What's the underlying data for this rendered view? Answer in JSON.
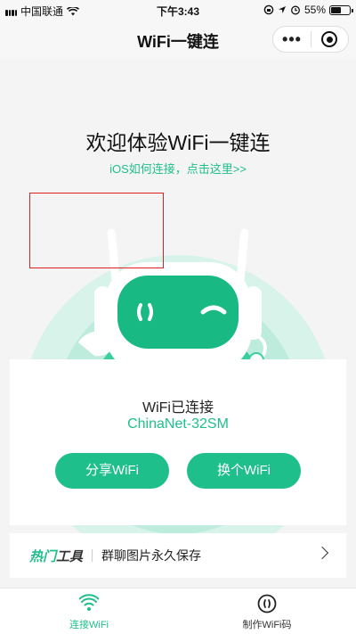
{
  "status_bar": {
    "carrier": "中国联通",
    "time": "下午3:43",
    "battery": "55%",
    "battery_level": 0.55
  },
  "nav": {
    "title": "WiFi一键连",
    "more_icon": "more-dots-icon",
    "close_icon": "target-close-icon"
  },
  "hero": {
    "welcome": "欢迎体验WiFi一键连",
    "ios_link": "iOS如何连接，点击这里>>"
  },
  "card": {
    "status": "WiFi已连接",
    "ssid": "ChinaNet-32SM",
    "share_label": "分享WiFi",
    "switch_label": "换个WiFi"
  },
  "tools": {
    "label_prefix": "热门",
    "label_suffix": "工具",
    "text": "群聊图片永久保存"
  },
  "tabs": [
    {
      "label": "连接WiFi",
      "icon": "wifi-icon",
      "active": true
    },
    {
      "label": "制作WiFi码",
      "icon": "wifi-code-icon",
      "active": false
    }
  ],
  "colors": {
    "accent": "#1ebf8a",
    "highlight": "#e02020"
  }
}
